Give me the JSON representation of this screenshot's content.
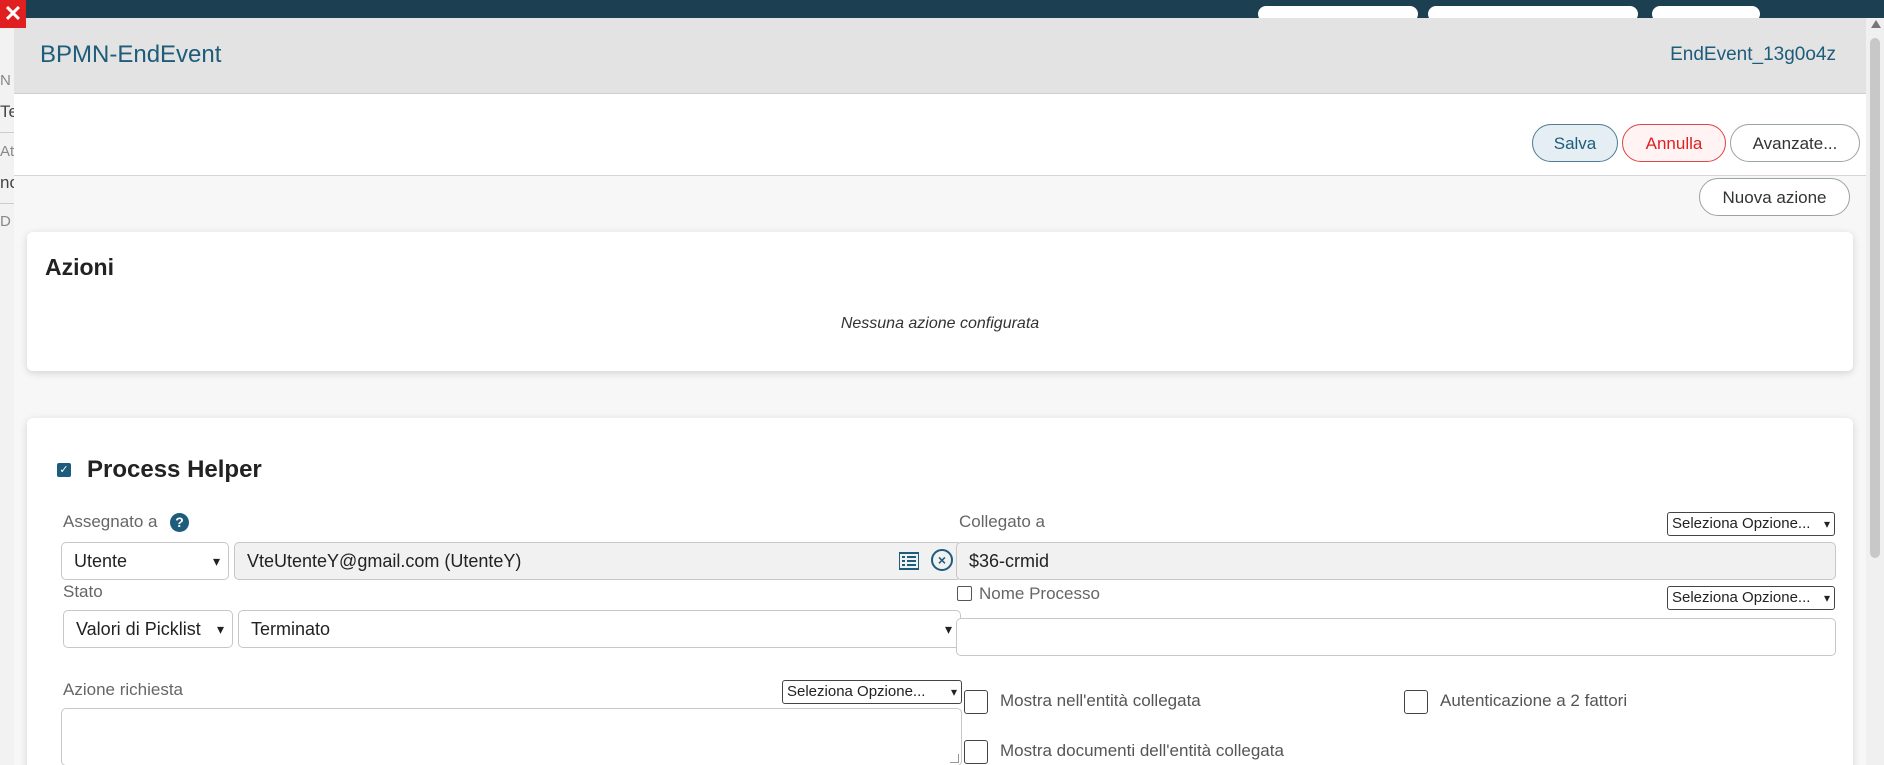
{
  "background": {
    "snippets": [
      "N",
      "Te",
      "At",
      "nc",
      "D"
    ]
  },
  "modal": {
    "title": "BPMN-EndEvent",
    "element_id": "EndEvent_13g0o4z",
    "close_icon": "close-icon"
  },
  "toolbar": {
    "save_label": "Salva",
    "cancel_label": "Annulla",
    "advanced_label": "Avanzate..."
  },
  "actions": {
    "new_action_label": "Nuova azione",
    "title": "Azioni",
    "empty_message": "Nessuna azione configurata"
  },
  "process_helper": {
    "title": "Process Helper",
    "checked": true,
    "assigned_to": {
      "label": "Assegnato a",
      "help": "?",
      "type_value": "Utente",
      "user_value": "VteUtenteY@gmail.com (UtenteY)"
    },
    "linked_to": {
      "label": "Collegato a",
      "option_select": "Seleziona Opzione...",
      "value": "$36-crmid"
    },
    "state": {
      "label": "Stato",
      "source_value": "Valori di Picklist",
      "value": "Terminato"
    },
    "process_name": {
      "label": "Nome Processo",
      "option_select": "Seleziona Opzione...",
      "value": ""
    },
    "required_action": {
      "label": "Azione richiesta",
      "option_select": "Seleziona Opzione...",
      "value": ""
    },
    "checkboxes": {
      "show_in_linked": "Mostra nell'entità collegata",
      "two_factor": "Autenticazione a 2 fattori",
      "show_docs": "Mostra documenti dell'entità collegata"
    }
  },
  "colors": {
    "accent": "#1d5c7a",
    "danger": "#d22222",
    "header_bg": "#e3e3e3"
  }
}
